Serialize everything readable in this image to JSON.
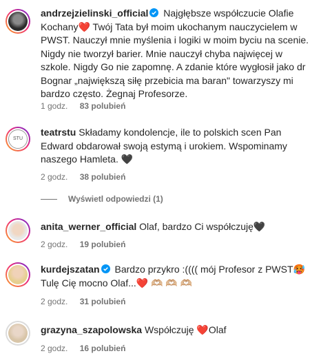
{
  "comments": [
    {
      "username": "andrzejzielinski_official",
      "verified": true,
      "text_lines": [
        "Najgłębsze współczucie Olafie",
        "Kochany❤️  Twój Tata był moim ukochanym nauczycielem w",
        "PWST. Nauczył mnie myślenia i logiki w moim byciu na scenie.",
        "Nigdy nie tworzył barier. Mnie nauczył chyba najwięcej w",
        "szkole. Nigdy Go nie zapomnę. A zdanie które wygłosił jako dr",
        "Bognar „największą siłę przebicia ma baran\" towarzyszy mi",
        "bardzo często. Żegnaj Profesorze."
      ],
      "time": "1 godz.",
      "likes": "83 polubień"
    },
    {
      "username": "teatrstu",
      "verified": false,
      "text_lines": [
        "Składamy kondolencje, ile to polskich scen Pan",
        "Edward obdarował swoją estymą i urokiem. Wspominamy",
        "naszego Hamleta. 🖤"
      ],
      "time": "2 godz.",
      "likes": "38 polubień"
    },
    {
      "username": "anita_werner_official",
      "verified": false,
      "text_lines": [
        "Olaf, bardzo Ci współczuję🖤"
      ],
      "time": "2 godz.",
      "likes": "19 polubień"
    },
    {
      "username": "kurdejszatan",
      "verified": true,
      "text_lines": [
        "Bardzo przykro :(((( mój Profesor z PWST🥵",
        "Tulę Cię mocno Olaf...❤️ 🫶🏼 🫶🏼 🫶🏼"
      ],
      "time": "2 godz.",
      "likes": "31 polubień"
    },
    {
      "username": "grazyna_szapolowska",
      "verified": false,
      "text_lines": [
        "Współczuję ❤️Olaf"
      ],
      "time": "2 godz.",
      "likes": "16 polubień"
    }
  ],
  "view_replies": "Wyświetl odpowiedzi (1)",
  "colors": {
    "verified": "#0095f6",
    "muted": "#737373",
    "text": "#262626",
    "heart": "#ed4956"
  }
}
